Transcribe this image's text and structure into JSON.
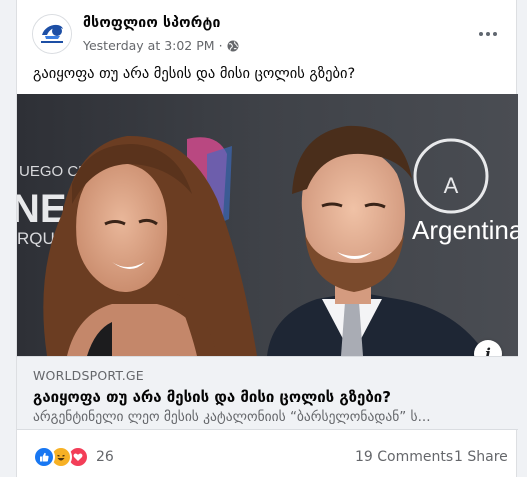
{
  "post": {
    "page_name": "მსოფლიო სპორტი",
    "timestamp": "Yesterday at 3:02 PM",
    "separator": "·",
    "privacy_icon": "globe-icon",
    "text": "გაიყოფა თუ არა მესის და მისი ცოლის გზები?"
  },
  "photo": {
    "backdrop_left_text_1": "UEGO CE",
    "backdrop_left_text_2": "NE",
    "backdrop_left_text_3": "RQU",
    "backdrop_right_logo": "A",
    "backdrop_right_text": "Argentina"
  },
  "link": {
    "domain": "WORLDSPORT.GE",
    "title": "გაიყოფა თუ არა მესის და მისი ცოლის გზები?",
    "description": "არგენტინელი ლეო მესის კატალონიის “ბარსელონადან” ს..."
  },
  "info_button": "i",
  "footer": {
    "reaction_count": "26",
    "comments": "19 Comments",
    "shares": "1 Share"
  },
  "colors": {
    "like": "#1877f2",
    "haha": "#f7b125",
    "love": "#f33e58"
  }
}
